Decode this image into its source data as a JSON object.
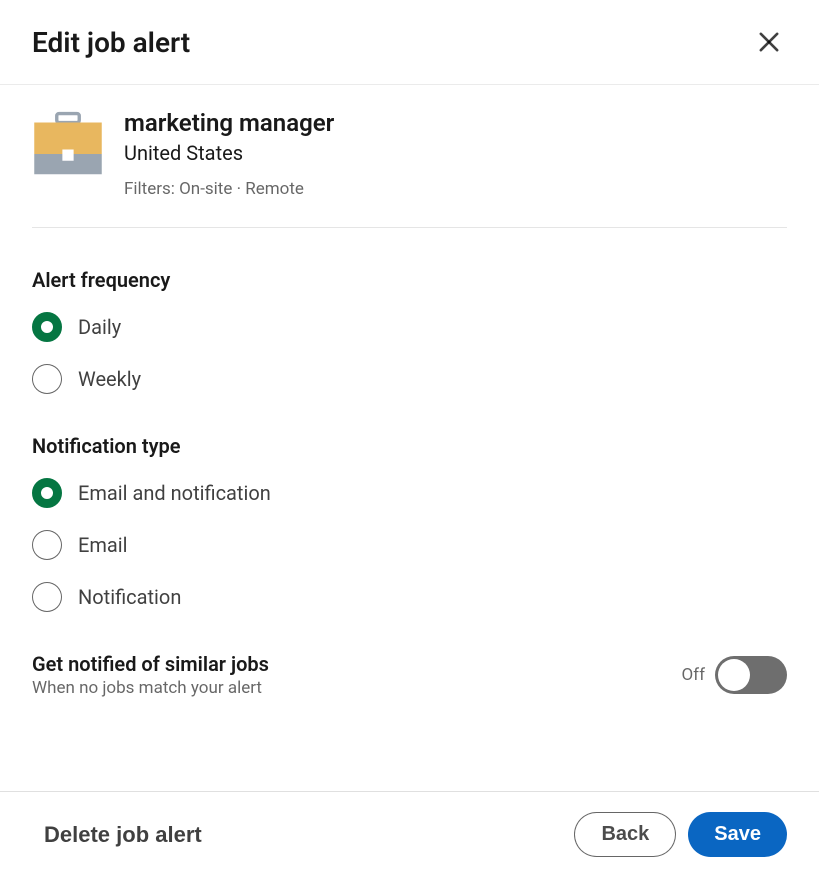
{
  "header": {
    "title": "Edit job alert"
  },
  "alert": {
    "title": "marketing manager",
    "location": "United States",
    "filters": "Filters: On-site · Remote"
  },
  "frequency": {
    "heading": "Alert frequency",
    "options": [
      {
        "label": "Daily",
        "selected": true
      },
      {
        "label": "Weekly",
        "selected": false
      }
    ]
  },
  "notification": {
    "heading": "Notification type",
    "options": [
      {
        "label": "Email and notification",
        "selected": true
      },
      {
        "label": "Email",
        "selected": false
      },
      {
        "label": "Notification",
        "selected": false
      }
    ]
  },
  "similar": {
    "title": "Get notified of similar jobs",
    "subtitle": "When no jobs match your alert",
    "state_label": "Off"
  },
  "footer": {
    "delete": "Delete job alert",
    "back": "Back",
    "save": "Save"
  }
}
